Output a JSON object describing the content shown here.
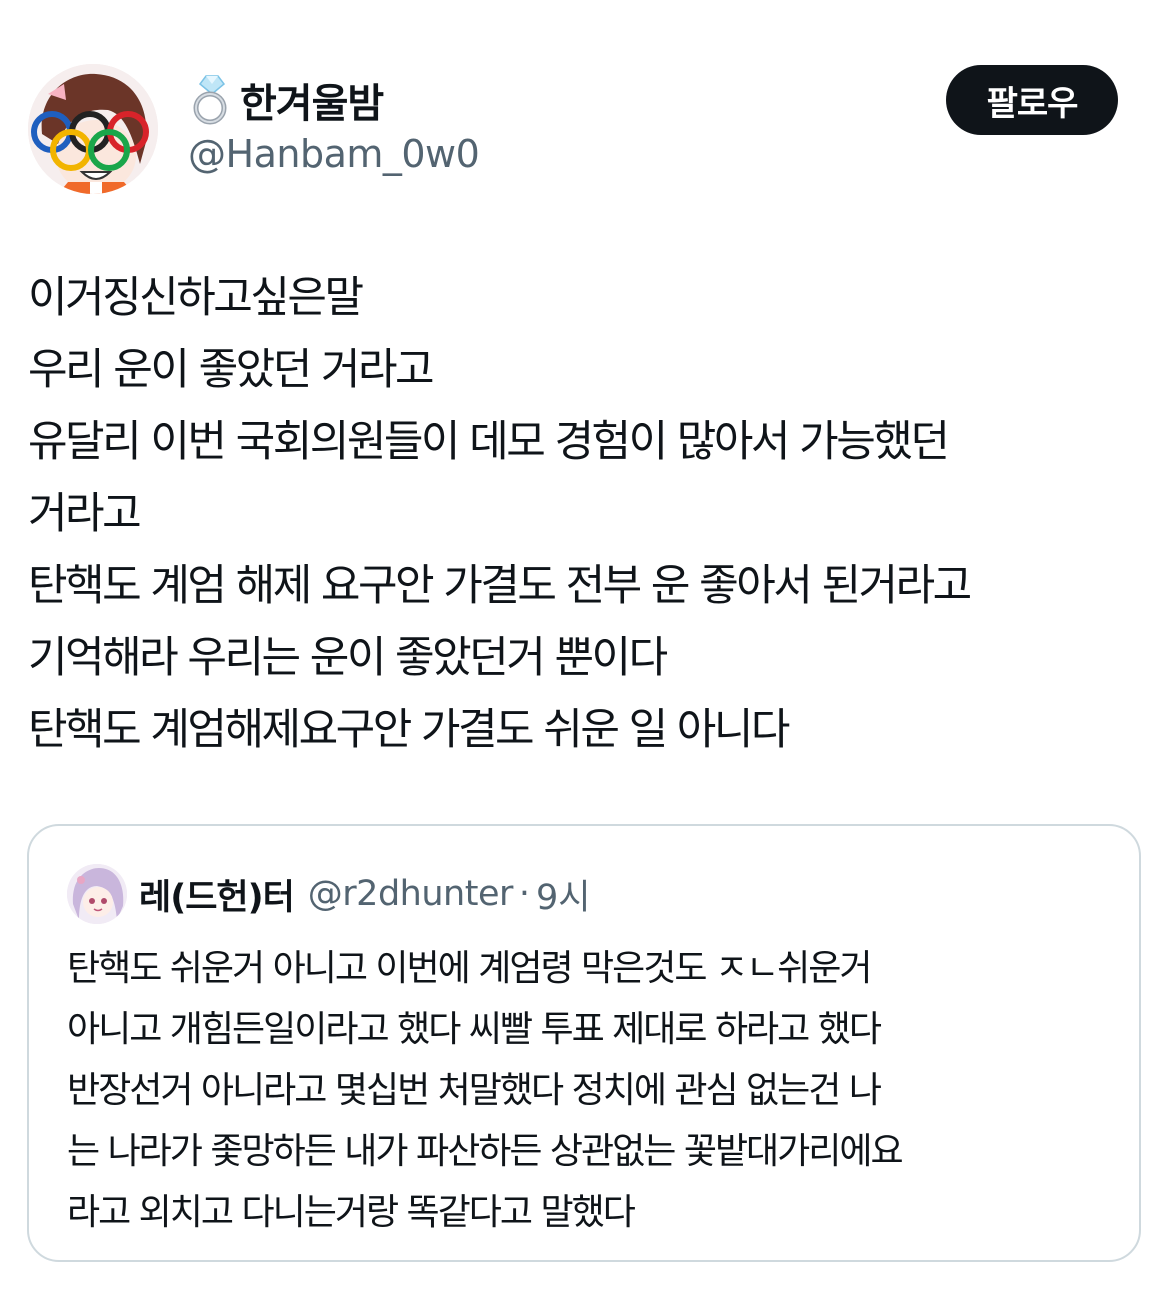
{
  "author": {
    "display_name": "한겨울밤",
    "name_emoji_icon": "ring-icon",
    "handle": "@Hanbam_0w0"
  },
  "follow_button": {
    "label": "팔로우"
  },
  "tweet": {
    "lines": [
      "이거징신하고싶은말",
      "우리 운이 좋았던 거라고",
      "유달리 이번 국회의원들이 데모 경험이 많아서 가능했던",
      "거라고",
      "탄핵도 계엄 해제 요구안 가결도 전부 운 좋아서 된거라고",
      "기억해라 우리는 운이 좋았던거 뿐이다",
      "탄핵도 계엄해제요구안 가결도 쉬운 일 아니다"
    ]
  },
  "quoted_tweet": {
    "display_name": "레(드헌)터",
    "handle": "@r2dhunter",
    "separator": "·",
    "time": "9시",
    "lines": [
      "탄핵도 쉬운거 아니고 이번에 계엄령 막은것도 ㅈㄴ쉬운거",
      "아니고 개힘든일이라고 했다 씨빨 투표 제대로 하라고 했다",
      "반장선거 아니라고 몇십번 처말했다 정치에 관심 없는건 나",
      "는 나라가 좇망하든 내가 파산하든 상관없는 꽃밭대가리에요",
      "라고 외치고 다니는거랑 똑같다고 말했다"
    ]
  },
  "colors": {
    "text_primary": "#0f1419",
    "text_secondary": "#536471",
    "button_bg": "#0f1419",
    "button_text": "#ffffff",
    "card_border": "#cfd9de"
  }
}
